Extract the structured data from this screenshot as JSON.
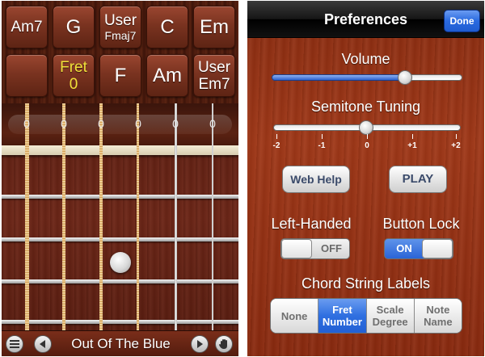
{
  "left": {
    "chords_row1": [
      {
        "line1": "Am7",
        "line2": ""
      },
      {
        "line1": "G",
        "line2": ""
      },
      {
        "line1": "User",
        "line2": "Fmaj7"
      },
      {
        "line1": "C",
        "line2": ""
      },
      {
        "line1": "Em",
        "line2": ""
      }
    ],
    "chords_row2": [
      {
        "line1": "",
        "line2": ""
      },
      {
        "line1": "Fret",
        "line2": "0"
      },
      {
        "line1": "F",
        "line2": ""
      },
      {
        "line1": "Am",
        "line2": ""
      },
      {
        "line1": "User",
        "line2": "Em7"
      }
    ],
    "string_numbers": [
      "0",
      "0",
      "0",
      "0",
      "0",
      "0"
    ],
    "song_title": "Out Of The Blue",
    "icons": {
      "menu": "menu-icon",
      "prev": "prev-arrow-icon",
      "next": "next-arrow-icon",
      "hand": "hand-icon"
    }
  },
  "right": {
    "header": {
      "title": "Preferences",
      "done_label": "Done"
    },
    "volume": {
      "label": "Volume",
      "value_fraction": 0.7
    },
    "tuning": {
      "label": "Semitone Tuning",
      "ticks": [
        "-2",
        "-1",
        "0",
        "+1",
        "+2"
      ],
      "value": 0
    },
    "buttons": {
      "web_help": "Web Help",
      "play": "PLAY"
    },
    "left_handed": {
      "label": "Left-Handed",
      "state": "OFF"
    },
    "button_lock": {
      "label": "Button Lock",
      "state": "ON"
    },
    "chord_string_labels": {
      "label": "Chord String Labels",
      "options": [
        {
          "line1": "None",
          "line2": ""
        },
        {
          "line1": "Fret",
          "line2": "Number"
        },
        {
          "line1": "Scale",
          "line2": "Degree"
        },
        {
          "line1": "Note",
          "line2": "Name"
        }
      ],
      "selected_index": 1
    }
  },
  "colors": {
    "accent_blue": "#2f6fe0",
    "fret_yellow": "#f1e13a",
    "wood": "#8a2c10"
  }
}
